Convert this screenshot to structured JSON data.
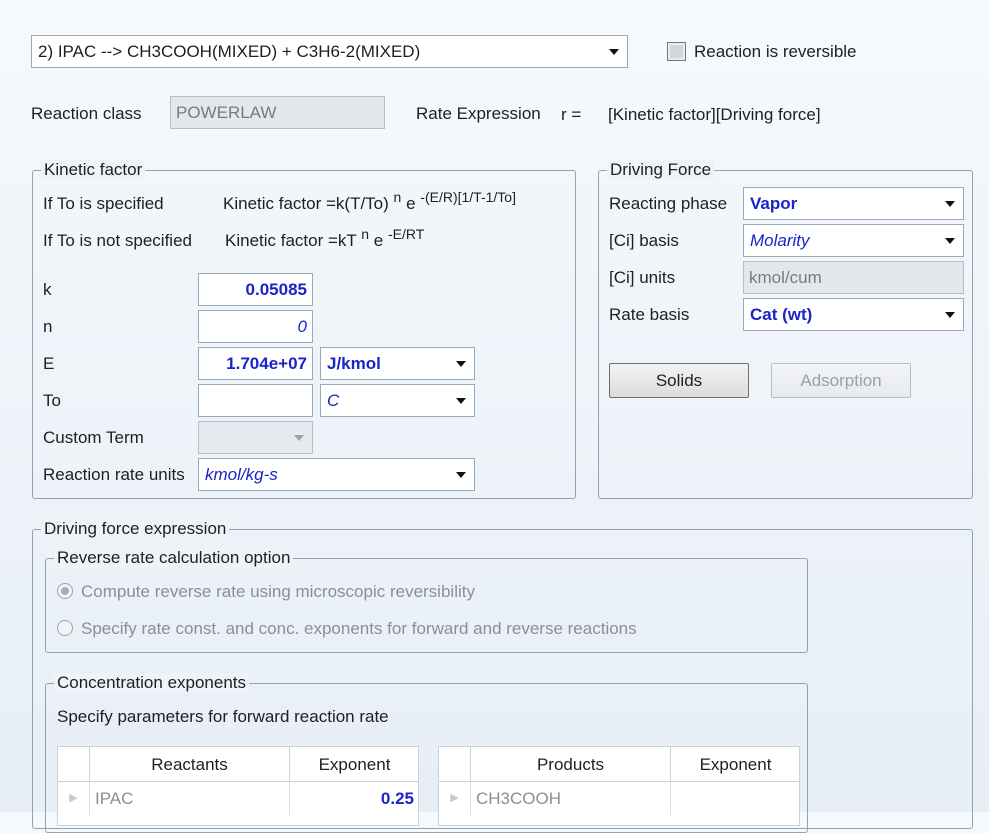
{
  "reaction_select": {
    "value": "2) IPAC   -->  CH3COOH(MIXED) + C3H6-2(MIXED)"
  },
  "reversible": {
    "label": "Reaction is reversible",
    "checked": false
  },
  "reaction_class": {
    "label": "Reaction class",
    "value": "POWERLAW"
  },
  "rate_expression": {
    "label": "Rate Expression",
    "r_eq": "r =",
    "formula": "[Kinetic factor][Driving force]"
  },
  "kinetic": {
    "title": "Kinetic factor",
    "to_specified": {
      "label": "If To is specified",
      "formula_pre": "Kinetic factor  =k(T/To)",
      "n": "n",
      "e": "e",
      "exp": "-(E/R)[1/T-1/To]"
    },
    "to_not_specified": {
      "label": "If To is not specified",
      "formula_pre": "Kinetic factor  =kT",
      "n": "n",
      "e": "e",
      "exp": "-E/RT"
    },
    "k": {
      "label": "k",
      "value": "0.05085"
    },
    "n": {
      "label": "n",
      "value": "0"
    },
    "E": {
      "label": "E",
      "value": "1.704e+07",
      "unit": "J/kmol"
    },
    "To": {
      "label": "To",
      "value": "",
      "unit": "C"
    },
    "custom_term": {
      "label": "Custom Term",
      "value": ""
    },
    "rate_units": {
      "label": "Reaction rate units",
      "value": "kmol/kg-s"
    }
  },
  "driving": {
    "title": "Driving Force",
    "reacting_phase": {
      "label": "Reacting phase",
      "value": "Vapor"
    },
    "ci_basis": {
      "label": "[Ci] basis",
      "value": "Molarity"
    },
    "ci_units": {
      "label": "[Ci] units",
      "value": "kmol/cum"
    },
    "rate_basis": {
      "label": "Rate basis",
      "value": "Cat (wt)"
    },
    "solids_button": "Solids",
    "adsorption_button": "Adsorption"
  },
  "dfe": {
    "title": "Driving force expression",
    "reverse": {
      "title": "Reverse rate calculation option",
      "option1": "Compute reverse rate using microscopic  reversibility",
      "option2": "Specify rate const. and conc. exponents for forward and reverse reactions"
    },
    "conc": {
      "title": "Concentration exponents",
      "desc": "Specify parameters for forward reaction rate",
      "reactants": {
        "headers": [
          "Reactants",
          "Exponent"
        ],
        "rows": [
          [
            "IPAC",
            "0.25"
          ]
        ]
      },
      "products": {
        "headers": [
          "Products",
          "Exponent"
        ],
        "rows": [
          [
            "CH3COOH",
            ""
          ]
        ]
      }
    }
  },
  "colors": {
    "accent": "#1a24c8",
    "border": "#8fa3b6"
  }
}
